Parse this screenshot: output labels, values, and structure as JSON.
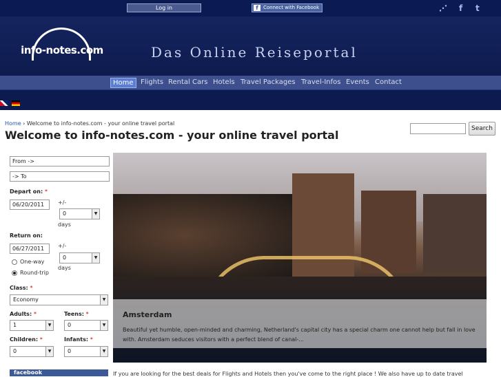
{
  "topbar": {
    "login_label": "Log in",
    "fb_connect_label": "Connect with Facebook",
    "rss_icon": "rss-icon",
    "facebook_icon": "facebook-icon",
    "twitter_icon": "twitter-icon"
  },
  "header": {
    "logo_text": "info-notes.com",
    "slogan": "Das Online Reiseportal"
  },
  "nav": {
    "items": [
      "Home",
      "Flights",
      "Rental Cars",
      "Hotels",
      "Travel Packages",
      "Travel-Infos",
      "Events",
      "Contact"
    ],
    "active": "Home"
  },
  "breadcrumb": {
    "home": "Home",
    "separator": " › ",
    "current": "Welcome to info-notes.com - your online travel portal"
  },
  "page_title": "Welcome to info-notes.com - your online travel portal",
  "search": {
    "value": "",
    "button_label": "Search"
  },
  "form": {
    "from_value": "From ->",
    "to_value": "-> To",
    "depart_label": "Depart on:",
    "depart_value": "06/20/2011",
    "plusminus": "+/-",
    "days": "days",
    "depart_flex": "0",
    "return_label": "Return on:",
    "return_value": "06/27/2011",
    "return_flex": "0",
    "one_way": "One-way",
    "round_trip": "Round-trip",
    "class_label": "Class:",
    "class_value": "Economy",
    "adults_label": "Adults:",
    "adults_value": "1",
    "teens_label": "Teens:",
    "teens_value": "0",
    "children_label": "Children:",
    "children_value": "0",
    "infants_label": "Infants:",
    "infants_value": "0",
    "required_mark": "*"
  },
  "facebook_box": "facebook",
  "feature": {
    "title": "Amsterdam",
    "text": "Beautiful yet humble, open-minded and charming, Netherland's capital city has a special charm one cannot help but fall in love with. Amsterdam seduces visitors with a perfect blend of canal-..."
  },
  "intro_text": "If you are looking for the best deals for Flights and Hotels then you've come to the right place ! We also have up to date travel"
}
